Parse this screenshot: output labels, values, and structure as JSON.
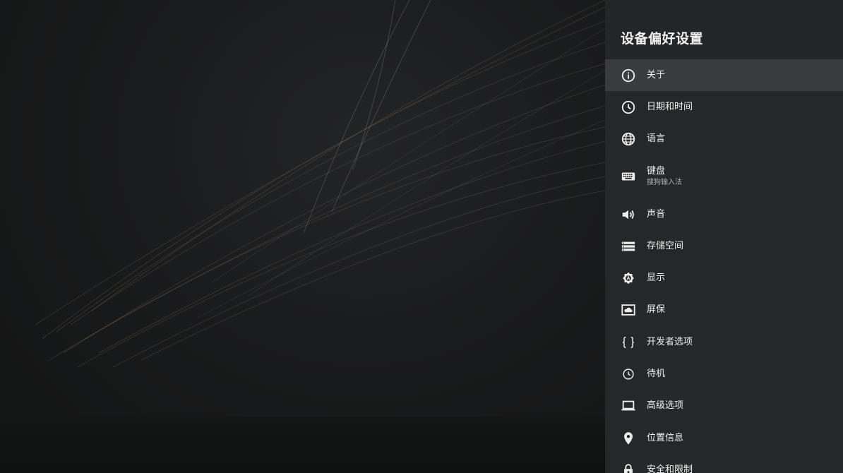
{
  "panel": {
    "title": "设备偏好设置",
    "items": [
      {
        "label": "关于",
        "icon": "info-icon",
        "selected": true
      },
      {
        "label": "日期和时间",
        "icon": "clock-icon"
      },
      {
        "label": "语言",
        "icon": "globe-icon"
      },
      {
        "label": "键盘",
        "sub": "搜狗输入法",
        "icon": "keyboard-icon"
      },
      {
        "label": "声音",
        "icon": "volume-icon"
      },
      {
        "label": "存储空间",
        "icon": "storage-icon"
      },
      {
        "label": "显示",
        "icon": "display-icon"
      },
      {
        "label": "屏保",
        "icon": "screensaver-icon"
      },
      {
        "label": "开发者选项",
        "icon": "developer-braces-icon"
      },
      {
        "label": "待机",
        "icon": "standby-clock-icon"
      },
      {
        "label": "高级选项",
        "icon": "laptop-icon"
      },
      {
        "label": "位置信息",
        "icon": "location-pin-icon"
      },
      {
        "label": "安全和限制",
        "icon": "lock-icon"
      }
    ]
  },
  "colors": {
    "panel_bg": "#262728",
    "selected_bg": "#3a3b3c",
    "text": "#eeeeee",
    "subtext": "#b0b0b0"
  }
}
